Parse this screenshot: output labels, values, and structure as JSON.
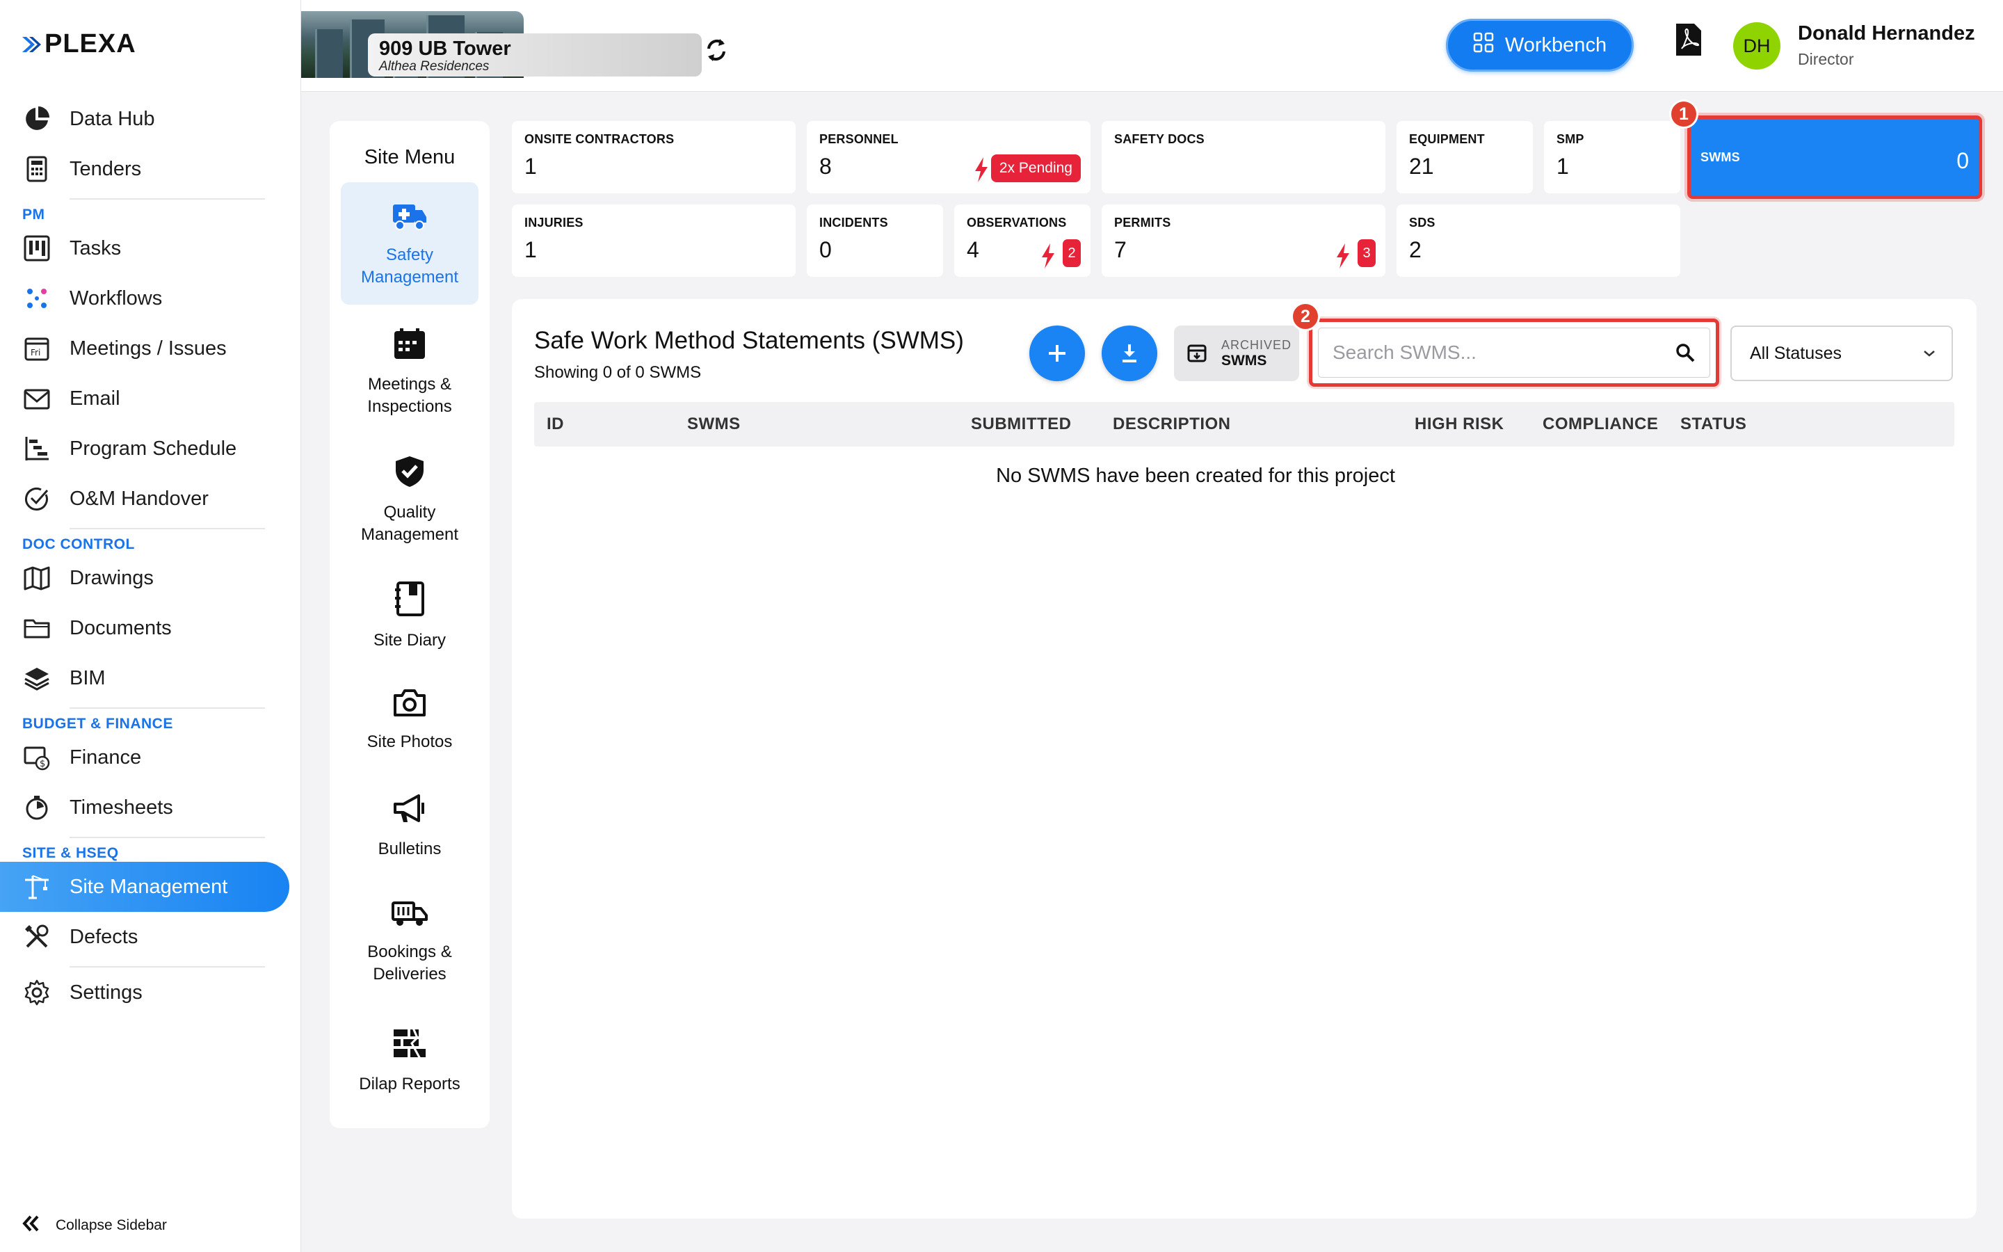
{
  "brand": {
    "logo_text": "PLEXA"
  },
  "sidebar": {
    "items": [
      {
        "label": "Data Hub",
        "icon": "pie-chart-icon"
      },
      {
        "label": "Tenders",
        "icon": "calculator-icon"
      },
      {
        "section": "PM"
      },
      {
        "label": "Tasks",
        "icon": "kanban-icon"
      },
      {
        "label": "Workflows",
        "icon": "workflow-icon"
      },
      {
        "label": "Meetings / Issues",
        "icon": "calendar-icon"
      },
      {
        "label": "Email",
        "icon": "envelope-icon"
      },
      {
        "label": "Program Schedule",
        "icon": "gantt-icon"
      },
      {
        "label": "O&M Handover",
        "icon": "check-circle-icon"
      },
      {
        "section": "DOC CONTROL"
      },
      {
        "label": "Drawings",
        "icon": "map-icon"
      },
      {
        "label": "Documents",
        "icon": "folder-icon"
      },
      {
        "label": "BIM",
        "icon": "layers-icon"
      },
      {
        "section": "BUDGET & FINANCE"
      },
      {
        "label": "Finance",
        "icon": "finance-icon"
      },
      {
        "label": "Timesheets",
        "icon": "stopwatch-icon"
      },
      {
        "section": "SITE & HSEQ"
      },
      {
        "label": "Site Management",
        "icon": "crane-icon",
        "active": true
      },
      {
        "label": "Defects",
        "icon": "tools-icon"
      },
      {
        "label": "Settings",
        "icon": "gear-icon"
      }
    ],
    "collapse_label": "Collapse Sidebar"
  },
  "project": {
    "name": "909 UB Tower",
    "subtitle": "Althea Residences"
  },
  "header": {
    "workbench_label": "Workbench"
  },
  "user": {
    "initials": "DH",
    "name": "Donald Hernandez",
    "role": "Director",
    "avatar_color": "#8fd400"
  },
  "site_menu": {
    "title": "Site Menu",
    "items": [
      {
        "label": "Safety Management",
        "icon": "ambulance-icon",
        "active": true
      },
      {
        "label": "Meetings & Inspections",
        "icon": "calendar-grid-icon"
      },
      {
        "label": "Quality Management",
        "icon": "shield-check-icon"
      },
      {
        "label": "Site Diary",
        "icon": "diary-icon"
      },
      {
        "label": "Site Photos",
        "icon": "camera-icon"
      },
      {
        "label": "Bulletins",
        "icon": "megaphone-icon"
      },
      {
        "label": "Bookings & Deliveries",
        "icon": "truck-icon"
      },
      {
        "label": "Dilap Reports",
        "icon": "broken-wall-icon"
      }
    ]
  },
  "stats": {
    "onsite_contractors": {
      "label": "ONSITE CONTRACTORS",
      "value": "1"
    },
    "personnel": {
      "label": "PERSONNEL",
      "value": "8",
      "pending": "2x Pending"
    },
    "safety_docs": {
      "label": "SAFETY DOCS",
      "value": ""
    },
    "equipment": {
      "label": "EQUIPMENT",
      "value": "21"
    },
    "smp": {
      "label": "SMP",
      "value": "1"
    },
    "swms": {
      "label": "SWMS",
      "value": "0"
    },
    "injuries": {
      "label": "INJURIES",
      "value": "1"
    },
    "incidents": {
      "label": "INCIDENTS",
      "value": "0"
    },
    "observations": {
      "label": "OBSERVATIONS",
      "value": "4",
      "alert": "2"
    },
    "permits": {
      "label": "PERMITS",
      "value": "7",
      "alert": "3"
    },
    "sds": {
      "label": "SDS",
      "value": "2"
    }
  },
  "annotations": {
    "step1": "1",
    "step2": "2"
  },
  "swms_panel": {
    "title": "Safe Work Method Statements (SWMS)",
    "subtitle": "Showing 0 of 0 SWMS",
    "archived_top": "ARCHIVED",
    "archived_bottom": "SWMS",
    "search_placeholder": "Search SWMS...",
    "status_filter": "All Statuses",
    "columns": [
      "ID",
      "SWMS",
      "SUBMITTED",
      "DESCRIPTION",
      "HIGH RISK",
      "COMPLIANCE",
      "STATUS"
    ],
    "empty_message": "No SWMS have been created for this project"
  },
  "colors": {
    "accent": "#1a84f5",
    "danger": "#e7233a",
    "highlight": "#e53935"
  }
}
